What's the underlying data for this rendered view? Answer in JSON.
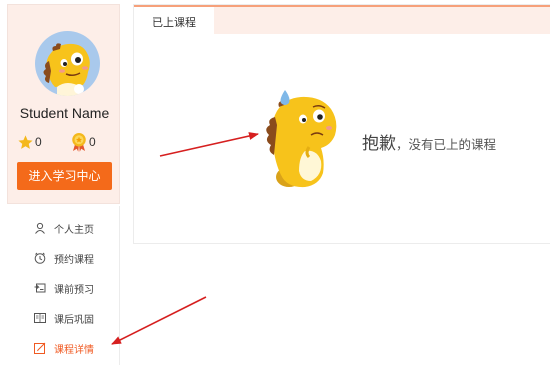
{
  "profile": {
    "student_name": "Student Name",
    "stars_count": "0",
    "medals_count": "0",
    "enter_center_label": "进入学习中心"
  },
  "sidebar": {
    "items": [
      {
        "label": "个人主页",
        "icon": "person-icon",
        "active": false
      },
      {
        "label": "预约课程",
        "icon": "clock-icon",
        "active": false
      },
      {
        "label": "课前预习",
        "icon": "preview-icon",
        "active": false
      },
      {
        "label": "课后巩固",
        "icon": "book-icon",
        "active": false
      },
      {
        "label": "课程详情",
        "icon": "edit-icon",
        "active": true
      }
    ]
  },
  "main": {
    "tab_label": "已上课程",
    "empty_title": "抱歉",
    "empty_subtitle": "，没有已上的课程"
  },
  "colors": {
    "accent": "#f46a1a",
    "active_text": "#f05a22",
    "card_bg": "#fdeee8",
    "arrow": "#d61f1f"
  }
}
